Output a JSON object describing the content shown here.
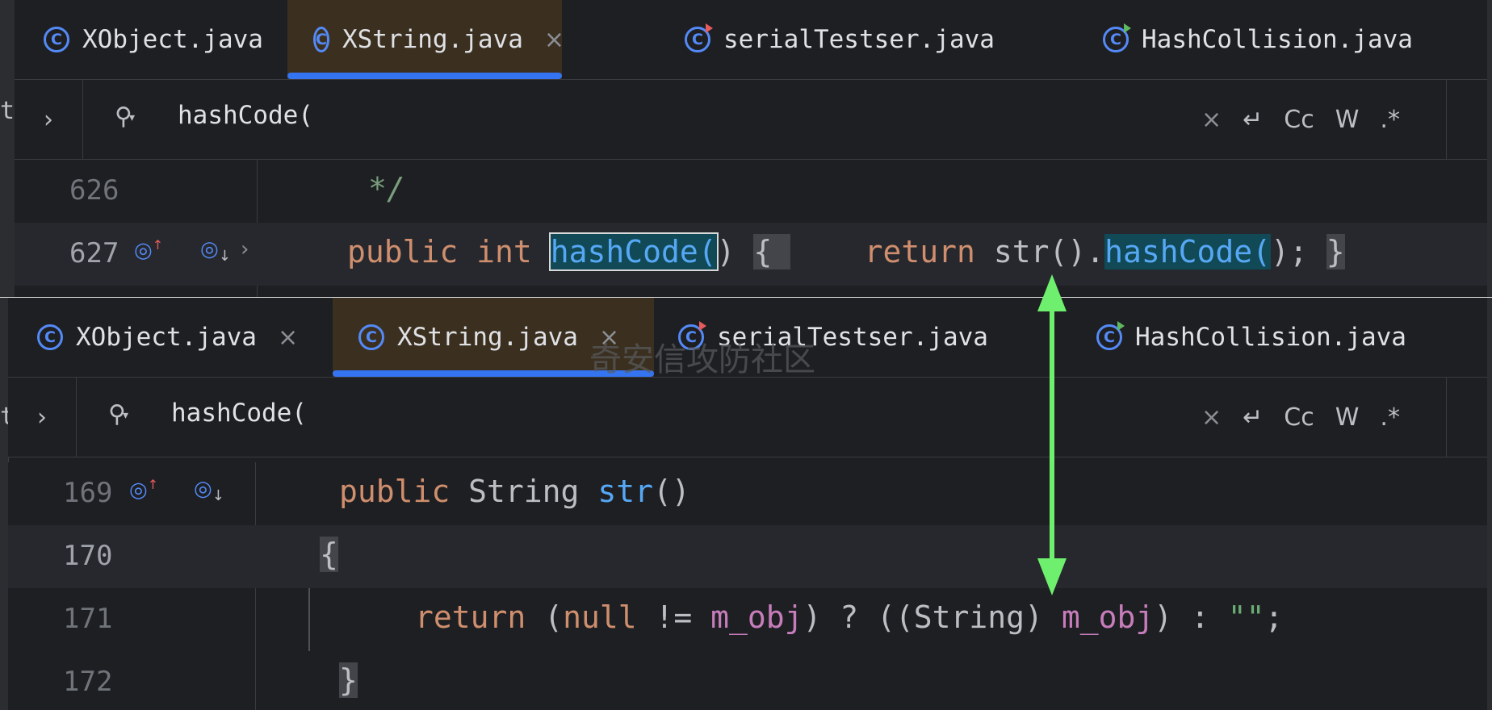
{
  "top": {
    "tabs": [
      {
        "label": "XObject.java",
        "close": "×"
      },
      {
        "label": "XString.java",
        "close": "×"
      },
      {
        "label": "serialTestser.java"
      },
      {
        "label": "HashCollision.java"
      }
    ],
    "find": {
      "expand": "›",
      "query": "hashCode(",
      "options": {
        "clear": "×",
        "wrap": "↵",
        "match_case": "Cc",
        "words": "W",
        "regex": ".*"
      }
    },
    "lines": [
      {
        "num": "626"
      },
      {
        "num": "627"
      }
    ],
    "strip_char": "t"
  },
  "bottom": {
    "tabs": [
      {
        "label": "XObject.java",
        "close": "×"
      },
      {
        "label": "XString.java",
        "close": "×"
      },
      {
        "label": "serialTestser.java"
      },
      {
        "label": "HashCollision.java"
      }
    ],
    "find": {
      "expand": "›",
      "query": "hashCode(",
      "options": {
        "clear": "×",
        "wrap": "↵",
        "match_case": "Cc",
        "words": "W",
        "regex": ".*"
      }
    },
    "lines": [
      {
        "num": "169"
      },
      {
        "num": "170"
      },
      {
        "num": "171"
      },
      {
        "num": "172"
      }
    ],
    "strip_char": "t",
    "watermark": "奇安信攻防社区"
  },
  "colors": {
    "accent": "#3574f0",
    "arrow": "#6ef06e",
    "keyword": "#cf8e6d",
    "function": "#56a8f5",
    "field": "#c77dbb",
    "string": "#6aab73"
  }
}
